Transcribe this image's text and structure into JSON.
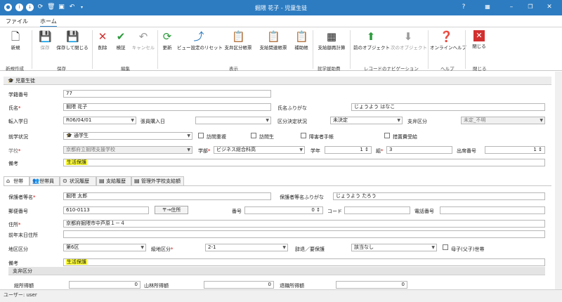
{
  "window": {
    "title": "掘隈 花子 - 児童生徒"
  },
  "menu": {
    "file": "ファイル",
    "home": "ホーム"
  },
  "ribbon": {
    "buttons": {
      "new": "新規",
      "save": "保存",
      "save_close": "保存して閉じる",
      "delete": "削除",
      "verify": "検証",
      "cancel": "キャンセル",
      "refresh": "更新",
      "reset_view": "ビュー設定のリセット",
      "support_form": "支弁区分帳票",
      "support_related_form": "支給関連帳票",
      "aux_form": "補助帳",
      "support_recalc": "支給額再計算",
      "prev_object": "前のオブジェクト",
      "next_object": "次のオブジェクト",
      "online_help": "オンラインヘルプ",
      "close": "閉じる"
    },
    "groups": {
      "new_create": "新規作成",
      "save": "保存",
      "edit": "編集",
      "display": "表示",
      "school_aid": "就学援助費",
      "record_nav": "レコードのナビゲーション",
      "help": "ヘルプ",
      "close": "閉じる"
    }
  },
  "student": {
    "section_title": "児童生徒",
    "labels": {
      "student_no": "学籍番号",
      "name": "氏名",
      "name_kana": "氏名ふりがな",
      "transfer_date": "転入学日",
      "enroll_date": "張員購入日",
      "decision_status": "区分決定状況",
      "support_class": "支弁区分",
      "enrollment_status": "就学状況",
      "school": "学校",
      "department": "学部",
      "grade": "学年",
      "class": "組",
      "attendance_no": "出席番号",
      "note": "備考"
    },
    "values": {
      "student_no": "77",
      "name": "掘隈 花子",
      "name_kana": "じょうよう はなこ",
      "transfer_date": "R06/04/01",
      "enroll_date": "",
      "decision_status": "未決定",
      "support_class": "未定_不明",
      "enrollment_status": "通学生",
      "school": "京都府立掘隈支援学校",
      "department": "ビジネス総合科高",
      "grade": "1",
      "class": "3",
      "attendance_no": "1",
      "note": "生活保護"
    },
    "checkboxes": {
      "visiting": "訪問重複",
      "home_visit": "訪問生",
      "disability_book": "障害者手帳",
      "special_measure": "措置費受給"
    }
  },
  "tabs": [
    "世帯",
    "世帯員",
    "状況履歴",
    "支給履歴",
    "管理外学校支給額"
  ],
  "household": {
    "labels": {
      "guardian_name": "保護者等名",
      "guardian_kana": "保護者等名ふりがな",
      "postal_code": "郵便番号",
      "address_button": "〒→住所",
      "house_no": "番号",
      "code": "コード",
      "phone": "電話番号",
      "address": "住所",
      "prev_address": "前年末日住所",
      "district": "地区区分",
      "grade_class": "級地区分",
      "welfare_status": "辞退／要保護",
      "single_parent": "母子(父子)世帯",
      "note": "備考",
      "support_section": "支弁区分",
      "income_total": "総所得額",
      "mountain_income": "山林所得額",
      "retirement_income": "退職所得額"
    },
    "values": {
      "guardian_name": "掘隈 太郎",
      "guardian_kana": "じょうよう たろう",
      "postal_code": "610-0113",
      "house_no": "0",
      "code": "",
      "phone": "",
      "address": "京都府掘隈市中芦原１－４",
      "prev_address": "",
      "district": "第6区",
      "grade_class": "2-1",
      "welfare_status": "該当なし",
      "note": "生活保護",
      "income_total": "0",
      "mountain_income": "0",
      "retirement_income": "0"
    }
  },
  "status": {
    "user": "ユーザー: user"
  }
}
